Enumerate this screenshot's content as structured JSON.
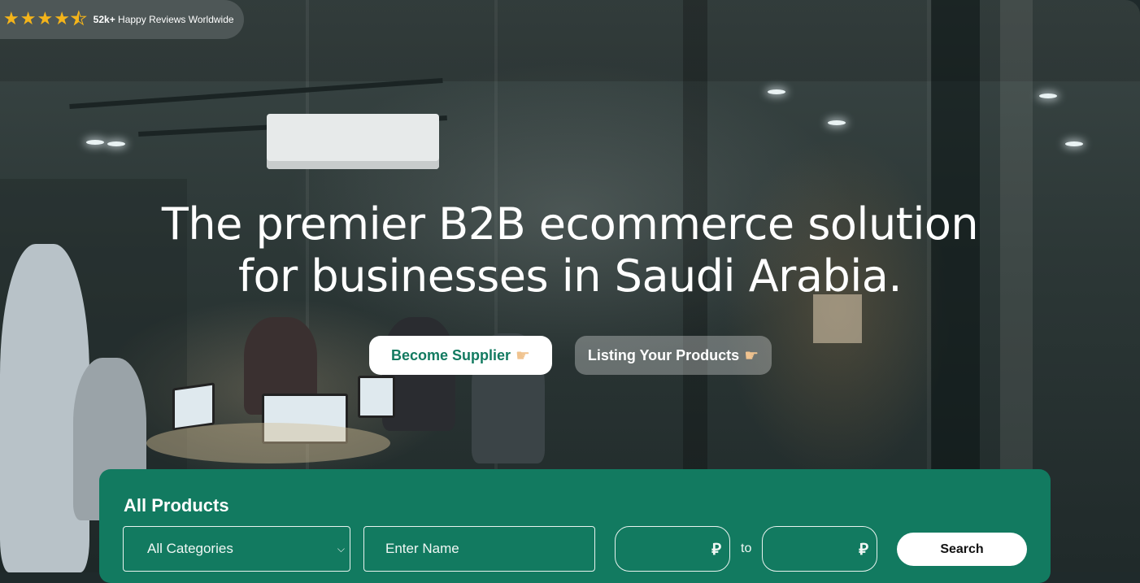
{
  "rating": {
    "stars": 4.5,
    "count": "52k+",
    "text": "Happy Reviews Worldwide"
  },
  "hero": {
    "headline_line1": "The premier B2B ecommerce solution",
    "headline_line2": "for businesses in Saudi Arabia.",
    "primary_button": "Become Supplier",
    "secondary_button": "Listing Your Products",
    "button_icon": "pointing-hand-icon"
  },
  "search_panel": {
    "title": "All Products",
    "category_select": "All Categories",
    "name_placeholder": "Enter Name",
    "min_price_currency": "⃁",
    "to_label": "to",
    "max_price_currency": "⃁",
    "search_button": "Search"
  },
  "colors": {
    "brand_green": "#127a60",
    "star_gold": "#f4b41a"
  }
}
